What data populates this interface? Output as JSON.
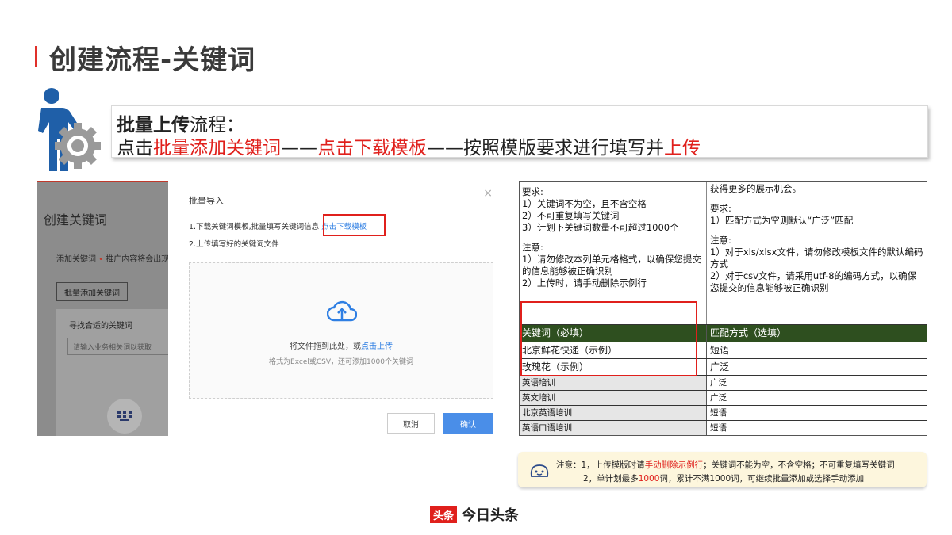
{
  "page": {
    "title": "创建流程-关键词"
  },
  "flow": {
    "bold": "批量上传",
    "title_rest": "流程：",
    "line2": [
      {
        "text": "点击",
        "red": false
      },
      {
        "text": "批量添加关键词",
        "red": true
      },
      {
        "text": "——",
        "red": false
      },
      {
        "text": "点击下载模板",
        "red": true
      },
      {
        "text": "——按照模版要求进行填写并",
        "red": false
      },
      {
        "text": "上传",
        "red": true
      }
    ]
  },
  "screenshot_left": {
    "background": {
      "title": "创建关键词",
      "sub_label": "添加关键词",
      "sub_dot": "•",
      "sub_hint": "推广内容将会出现",
      "batch_button": "批量添加关键词",
      "find_label": "寻找合适的关键词",
      "input_placeholder": "请输入业务相关词以获取",
      "keyboard_icon": "keyboard-icon"
    },
    "modal": {
      "title": "批量导入",
      "close": "×",
      "step1_text": "1.下载关键词模板,批量填写关键词信息",
      "step1_link": "点击下载模板",
      "step2_text": "2.上传填写好的关键词文件",
      "drop_text": "将文件拖到此处，或",
      "drop_link": "点击上传",
      "drop_hint": "格式为Excel或CSV，还可添加1000个关键词",
      "cancel": "取消",
      "confirm": "确认"
    }
  },
  "template": {
    "left_notes": {
      "req_title": "要求:",
      "req_1": "1）关键词不为空，且不含空格",
      "req_2": "2）不可重复填写关键词",
      "req_3": "3）计划下关键词数量不可超过1000个",
      "note_title": "注意:",
      "note_1": "1）请勿修改本列单元格格式，以确保您提交的信息能够被正确识别",
      "note_2": "2）上传时，请手动删除示例行"
    },
    "right_notes": {
      "top": "获得更多的展示机会。",
      "req_title": "要求:",
      "req_1": "1）匹配方式为空则默认“广泛”匹配",
      "note_title": "注意:",
      "note_1": "1）对于xls/xlsx文件，请勿修改模板文件的默认编码方式",
      "note_2": "2）对于csv文件，请采用utf-8的编码方式，以确保您提交的信息能够被正确识别"
    },
    "header": [
      "关键词（必填）",
      "匹配方式（选填）"
    ],
    "examples": [
      [
        "北京鲜花快递（示例）",
        "短语"
      ],
      [
        "玫瑰花（示例）",
        "广泛"
      ]
    ],
    "rows": [
      [
        "英语培训",
        "广泛"
      ],
      [
        "英文培训",
        "广泛"
      ],
      [
        "北京英语培训",
        "短语"
      ],
      [
        "英语口语培训",
        "短语"
      ]
    ]
  },
  "note": {
    "prefix": "注意：1，上传模版时请",
    "highlight": "手动删除示例行",
    "rest": "；关键词不能为空，不含空格；不可重复填写关键词",
    "line2_prefix": "2，单计划最多",
    "line2_highlight": "1000",
    "line2_rest": "词，累计不满1000词，可继续批量添加或选择手动添加"
  },
  "footer": {
    "badge": "头条",
    "brand": "今日头条"
  },
  "colors": {
    "accent_red": "#e0201c",
    "link_blue": "#2f7fe3",
    "person_blue": "#1f5fa8",
    "header_green": "#2e4f1f"
  }
}
